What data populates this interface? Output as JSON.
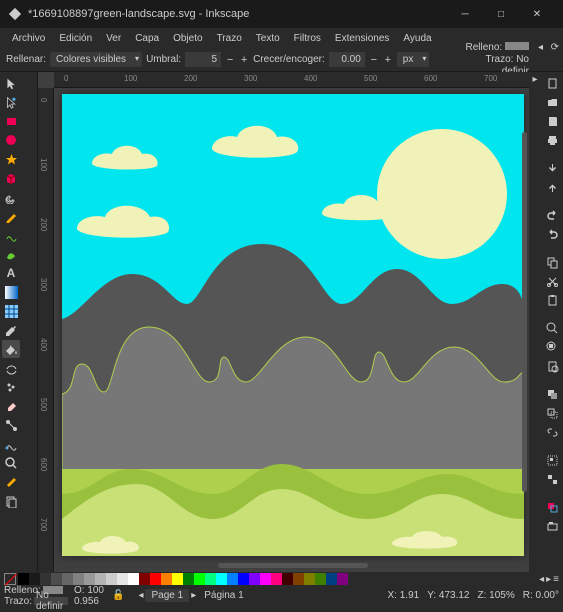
{
  "title": "*1669108897green-landscape.svg - Inkscape",
  "menu": [
    "Archivo",
    "Edición",
    "Ver",
    "Capa",
    "Objeto",
    "Trazo",
    "Texto",
    "Filtros",
    "Extensiones",
    "Ayuda"
  ],
  "toolbar": {
    "fill_label": "Rellenar:",
    "fill_mode": "Colores visibles",
    "threshold_label": "Umbral:",
    "threshold": "5",
    "grow_label": "Crecer/encoger:",
    "grow": "0.00",
    "unit": "px"
  },
  "side": {
    "fill_label": "Relleno:",
    "stroke_label": "Trazo:",
    "stroke_value": "No definir"
  },
  "ruler_h": [
    "0",
    "100",
    "200",
    "300",
    "400",
    "500",
    "600",
    "700"
  ],
  "ruler_v": [
    "0",
    "100",
    "200",
    "300",
    "400",
    "500",
    "600",
    "700"
  ],
  "status": {
    "fill_label": "Relleno:",
    "stroke_label": "Trazo:",
    "stroke_value": "No definir",
    "opacity_label": "O:",
    "opacity": "100",
    "stroke_w": "0.956",
    "page_label": "Page 1",
    "page_info": "Página  1",
    "x_label": "X:",
    "x": "1.91",
    "y_label": "Y:",
    "y": "473.12",
    "z_label": "Z:",
    "z": "105%",
    "r_label": "R:",
    "r": "0.00°"
  },
  "palette": [
    "#000",
    "#1a1a1a",
    "#333",
    "#4d4d4d",
    "#666",
    "#808080",
    "#999",
    "#b3b3b3",
    "#ccc",
    "#e6e6e6",
    "#fff",
    "#800000",
    "#f00",
    "#ff8000",
    "#ff0",
    "#008000",
    "#0f0",
    "#00ff80",
    "#0ff",
    "#0080ff",
    "#00f",
    "#8000ff",
    "#f0f",
    "#ff0080",
    "#400000",
    "#804000",
    "#808000",
    "#408000",
    "#004080",
    "#800080"
  ]
}
